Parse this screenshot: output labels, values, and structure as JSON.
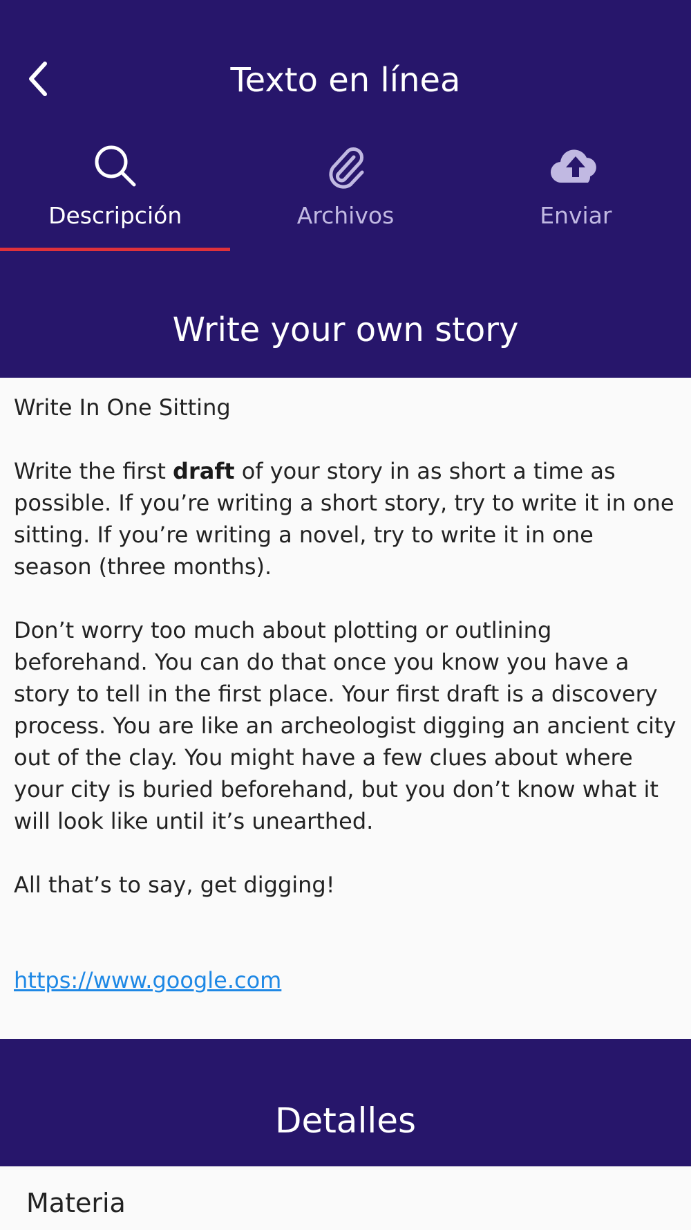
{
  "header": {
    "title": "Texto en línea",
    "back_icon": "chevron-left-icon"
  },
  "tabs": [
    {
      "label": "Descripción",
      "icon": "search-icon",
      "active": true
    },
    {
      "label": "Archivos",
      "icon": "paperclip-icon",
      "active": false
    },
    {
      "label": "Enviar",
      "icon": "cloud-upload-icon",
      "active": false
    }
  ],
  "assignment": {
    "title": "Write your own story",
    "heading": "Write In One Sitting",
    "p1_before": "Write the first ",
    "p1_bold": "draft",
    "p1_after": " of your story in as short a time as possible. If you’re writing a short story, try to write it in one sitting. If you’re writing a novel, try to write it in one season (three months).",
    "p2": "Don’t worry too much about plotting or outlining beforehand. You can do that once you know you have a story to tell in the first place. Your first draft is a discovery process. You are like an archeologist digging an ancient city out of the clay. You might have a few clues about where your city is buried beforehand, but you don’t know what it will look like until it’s unearthed.",
    "p3": "All that’s to say, get digging!",
    "link": "https://www.google.com"
  },
  "details": {
    "title": "Detalles",
    "subject_label": "Materia",
    "subject_value": ""
  },
  "colors": {
    "primary": "#27166b",
    "tab_indicator": "#e0313a",
    "inactive_tab": "#c1b9e2",
    "link": "#1e88e5",
    "background": "#fafafa"
  }
}
